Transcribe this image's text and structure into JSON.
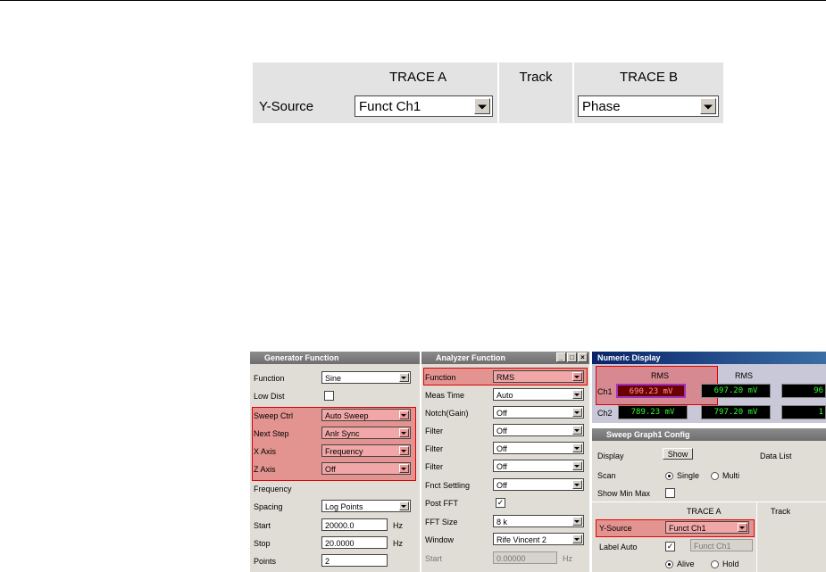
{
  "zoom": {
    "trace_a": "TRACE A",
    "track": "Track",
    "trace_b": "TRACE B",
    "y_source_label": "Y-Source",
    "trace_a_value": "Funct Ch1",
    "trace_b_value": "Phase"
  },
  "generator": {
    "title": "Generator Function",
    "function_label": "Function",
    "function_value": "Sine",
    "low_dist_label": "Low Dist",
    "sweep_ctrl_label": "Sweep Ctrl",
    "sweep_ctrl_value": "Auto Sweep",
    "next_step_label": "Next Step",
    "next_step_value": "Anlr Sync",
    "x_axis_label": "X Axis",
    "x_axis_value": "Frequency",
    "z_axis_label": "Z Axis",
    "z_axis_value": "Off",
    "frequency_label": "Frequency",
    "spacing_label": "Spacing",
    "spacing_value": "Log Points",
    "start_label": "Start",
    "start_value": "20000.0",
    "start_unit": "Hz",
    "stop_label": "Stop",
    "stop_value": "20.0000",
    "stop_unit": "Hz",
    "points_label": "Points",
    "points_value": "2"
  },
  "analyzer": {
    "title": "Analyzer Function",
    "function_label": "Function",
    "function_value": "RMS",
    "meas_time_label": "Meas Time",
    "meas_time_value": "Auto",
    "notch_label": "Notch(Gain)",
    "notch_value": "Off",
    "filter1_label": "Filter",
    "filter1_value": "Off",
    "filter2_label": "Filter",
    "filter2_value": "Off",
    "filter3_label": "Filter",
    "filter3_value": "Off",
    "fnct_settling_label": "Fnct Settling",
    "fnct_settling_value": "Off",
    "post_fft_label": "Post FFT",
    "post_fft_check": "✓",
    "fft_size_label": "FFT Size",
    "fft_size_value": "8 k",
    "window_label": "Window",
    "window_value": "Rife Vincent 2",
    "start_label": "Start",
    "start_value": "0.00000",
    "start_unit": "Hz"
  },
  "numeric": {
    "title": "Numeric Display",
    "col1": "RMS",
    "col2": "RMS",
    "ch1_label": "Ch1",
    "ch1_v1": "690.23 mV",
    "ch1_v2": "697.20 mV",
    "ch1_v3": "96",
    "ch2_label": "Ch2",
    "ch2_v1": "789.23 mV",
    "ch2_v2": "797.20 mV",
    "ch2_v3": "1"
  },
  "sweep": {
    "title": "Sweep Graph1 Config",
    "display_label": "Display",
    "show_button": "Show",
    "data_list": "Data List",
    "scan_label": "Scan",
    "single": "Single",
    "multi": "Multi",
    "show_min_max_label": "Show Min Max",
    "trace_a": "TRACE A",
    "track": "Track",
    "y_source_label": "Y-Source",
    "y_source_value": "Funct Ch1",
    "label_auto_label": "Label Auto",
    "label_auto_check": "✓",
    "label_value": "Funct Ch1",
    "alive": "Alive",
    "hold": "Hold"
  }
}
